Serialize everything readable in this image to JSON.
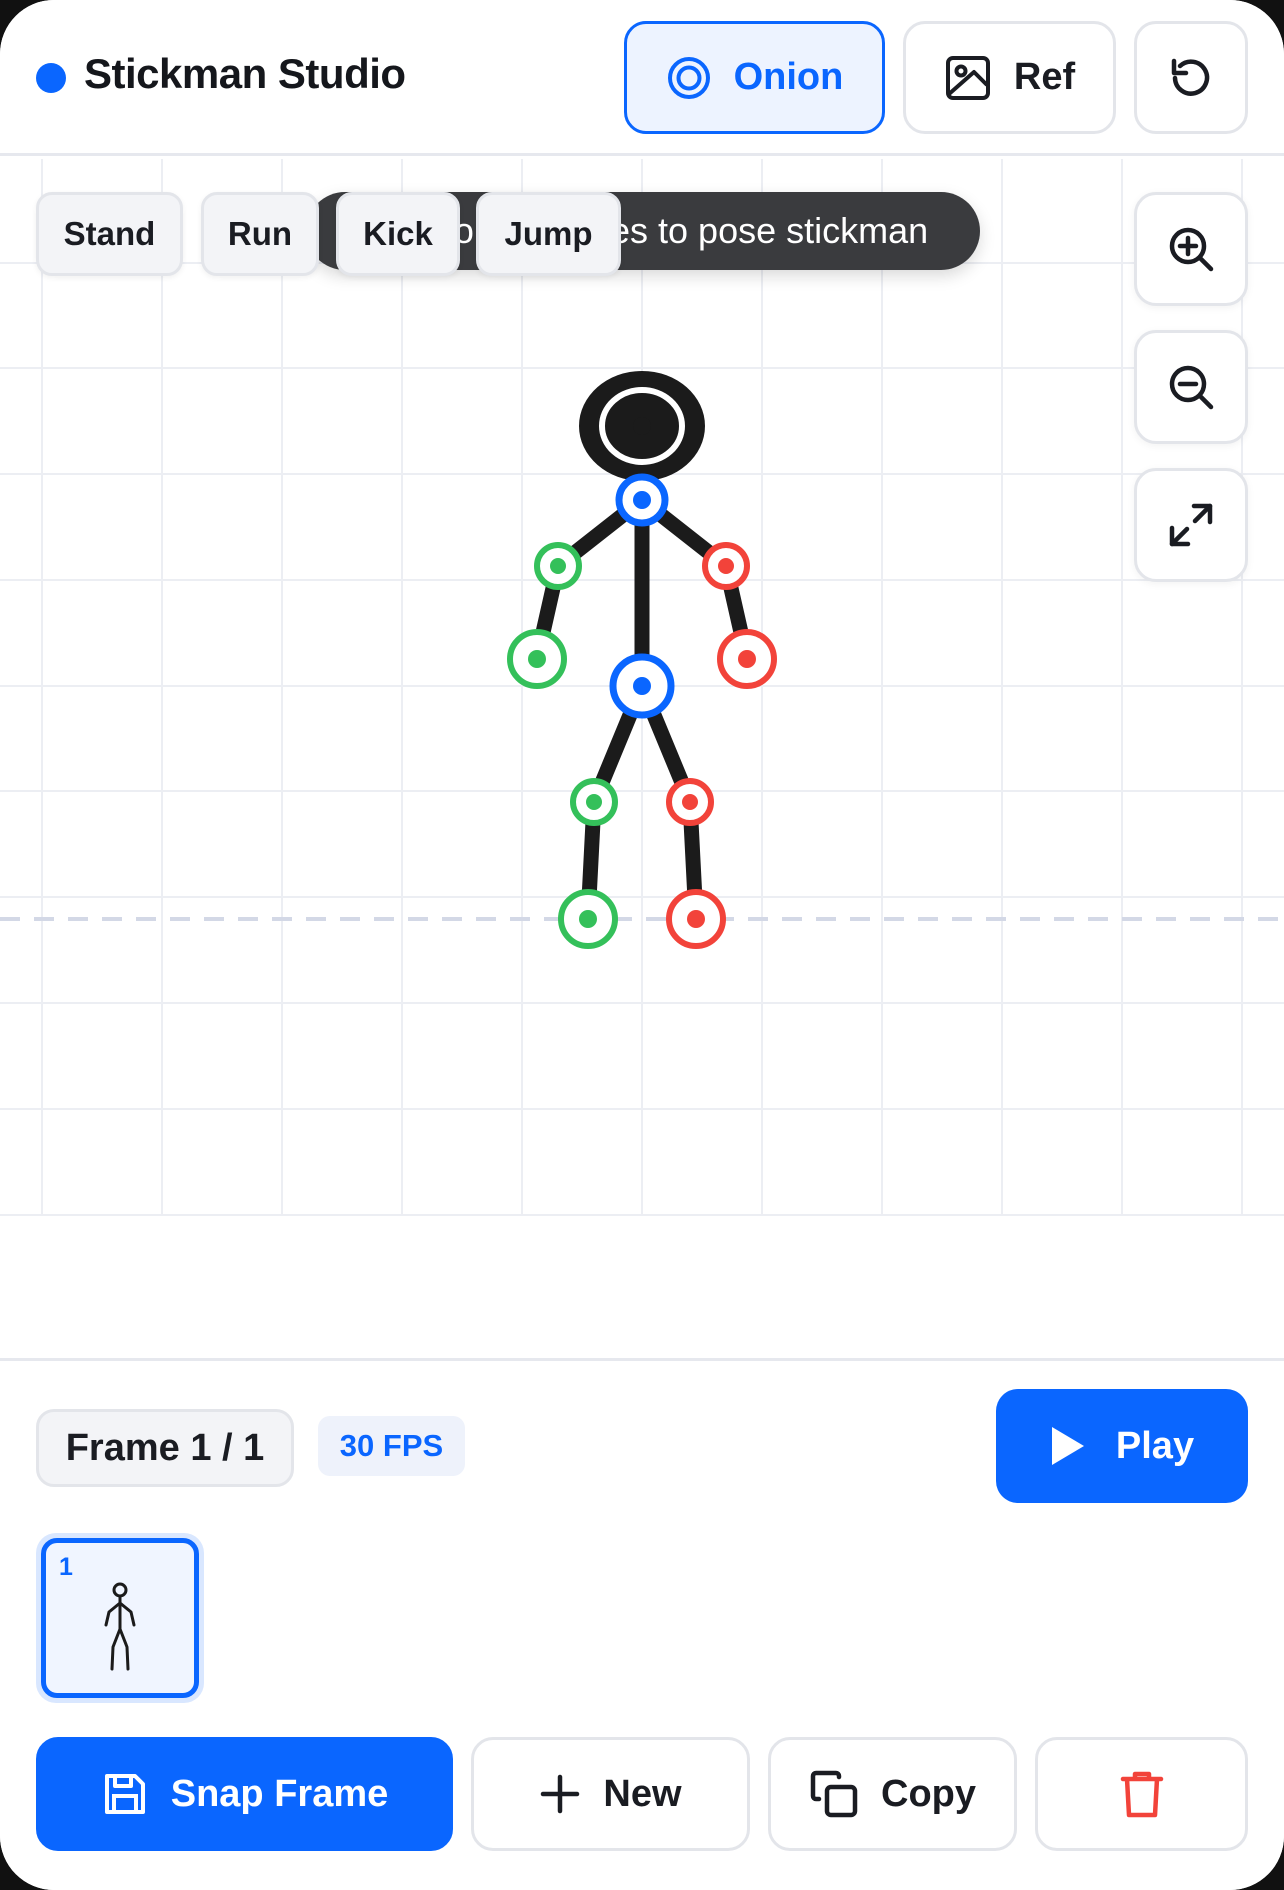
{
  "app": {
    "title": "Stickman Studio"
  },
  "header": {
    "onion_label": "Onion",
    "ref_label": "Ref",
    "onion_icon": "onion-rings-icon",
    "ref_icon": "image-icon",
    "undo_icon": "undo-icon"
  },
  "canvas": {
    "hint": "Drag joint handles to pose stickman",
    "poses": [
      "Stand",
      "Run",
      "Kick",
      "Jump"
    ],
    "zoom_in_icon": "zoom-in-icon",
    "zoom_out_icon": "zoom-out-icon",
    "fit_icon": "expand-icon"
  },
  "timeline": {
    "frame_label": "Frame 1 / 1",
    "fps_label": "30 FPS",
    "play_label": "Play",
    "frames": [
      {
        "number": "1"
      }
    ]
  },
  "actions": {
    "snap_label": "Snap Frame",
    "new_label": "New",
    "copy_label": "Copy",
    "delete_icon": "trash-icon"
  },
  "colors": {
    "accent": "#0a66ff",
    "left_joint": "#34c05a",
    "right_joint": "#f2433a",
    "core_joint": "#0a66ff",
    "bone": "#1b1b1b"
  }
}
